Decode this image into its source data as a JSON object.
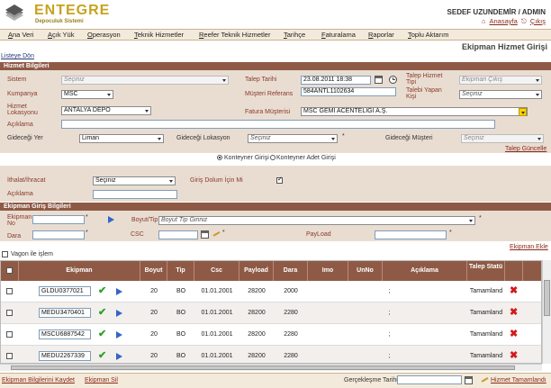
{
  "header": {
    "logo_title": "ENTEGRE",
    "logo_subtitle": "Depoculuk Sistemi",
    "user": "SEDEF UZUNDEMİR / ADMIN",
    "home_link": "Anasayfa",
    "logout_link": "Çıkış"
  },
  "menu": [
    "Ana Veri",
    "Açık Yük",
    "Operasyon",
    "Teknik Hizmetler",
    "Reefer Teknik Hizmetler",
    "Tarihçe",
    "Faturalama",
    "Raporlar",
    "Toplu Aktarım"
  ],
  "page_title": "Ekipman Hizmet Girişi",
  "back_link": "Listeye Dön",
  "sections": {
    "hizmet": "Hizmet Bilgileri",
    "ekipman_giris": "Ekipman Giriş Bilgileri"
  },
  "form": {
    "sistem_label": "Sistem",
    "sistem_value": "Seçiniz",
    "talep_tarihi_label": "Talep Tarihi",
    "talep_tarihi_value": "23.08.2011 18:38",
    "talep_hizmet_tipi_label": "Talep Hizmet Tipi",
    "talep_hizmet_tipi_value": "Ekipman Çıkış",
    "kumpanya_label": "Kumpanya",
    "kumpanya_value": "MSC",
    "musteri_referans_label": "Müşteri Referans",
    "musteri_referans_value": "584ANTL1102634",
    "talebi_yapan_kisi_label": "Talebi Yapan Kişi",
    "talebi_yapan_kisi_value": "Seçiniz",
    "hizmet_lokasyonu_label": "Hizmet Lokasyonu",
    "hizmet_lokasyonu_value": "ANTALYA DEPO",
    "fatura_musterisi_label": "Fatura Müşterisi",
    "fatura_musterisi_value": "MSC GEMİ ACENTELİĞİ A.Ş.",
    "aciklama_label": "Açıklama",
    "gidecegi_yer_label": "Gideceği Yer",
    "gidecegi_yer_value": "Liman",
    "gidecegi_lokasyon_label": "Gideceği Lokasyon",
    "gidecegi_lokasyon_value": "Seçiniz",
    "gidecegi_musteri_label": "Gideceği Müşteri",
    "gidecegi_musteri_value": "Seçiniz",
    "talep_guncelle_link": "Talep Güncelle",
    "radio_konteyner_giris": "Konteyner Girişi",
    "radio_konteyner_adet_giris": "Konteyner Adet Girişi",
    "ithalat_ihracat_label": "İthalat/İhracat",
    "ithalat_ihracat_value": "Seçiniz",
    "giris_dolum_label": "Giriş Dolum İçin Mi",
    "aciklama2_label": "Açıklama",
    "ekipman_no_label": "Ekipman No",
    "boyut_tip_label": "Boyut/Tip",
    "boyut_tip_placeholder": "Boyut Tip Giriniz",
    "dara_label": "Dara",
    "csc_label": "CSC",
    "payload_label": "PayLoad",
    "ekipman_ekle_link": "Ekipman Ekle",
    "vagon_label": "Vagon ile işlem"
  },
  "table": {
    "headers": [
      "Ekipman",
      "Boyut",
      "Tip",
      "Csc",
      "Payload",
      "Dara",
      "Imo",
      "UnNo",
      "Açıklama",
      "Talep Statü"
    ],
    "rows": [
      {
        "ekipman": "GLDU0377021",
        "boyut": "20",
        "tip": "BO",
        "csc": "01.01.2001",
        "payload": "28200",
        "dara": "2000",
        "imo": "",
        "unno": "",
        "aciklama": ";",
        "statu": "Tamamland"
      },
      {
        "ekipman": "MEDU3470401",
        "boyut": "20",
        "tip": "BO",
        "csc": "01.01.2001",
        "payload": "28200",
        "dara": "2280",
        "imo": "",
        "unno": "",
        "aciklama": ";",
        "statu": "Tamamland"
      },
      {
        "ekipman": "MSCU6887542",
        "boyut": "20",
        "tip": "BO",
        "csc": "01.01.2001",
        "payload": "28200",
        "dara": "2280",
        "imo": "",
        "unno": "",
        "aciklama": ";",
        "statu": "Tamamland"
      },
      {
        "ekipman": "MEDU2267339",
        "boyut": "20",
        "tip": "BO",
        "csc": "01.01.2001",
        "payload": "28200",
        "dara": "2280",
        "imo": "",
        "unno": "",
        "aciklama": ";",
        "statu": "Tamamland"
      }
    ]
  },
  "footer": {
    "kaydet_link": "Ekipman Bilgilerini Kaydet",
    "sil_link": "Ekipman Sil",
    "gerceklesme_label": "Gerçekleşme Tarihi",
    "hizmet_tamamlandi": "Hizmet Tamamlandı"
  },
  "colors": {
    "accent": "#8f5a45",
    "band": "#e9ddd2",
    "menu_bg": "#f4eadb",
    "logo": "#c7a21e"
  }
}
